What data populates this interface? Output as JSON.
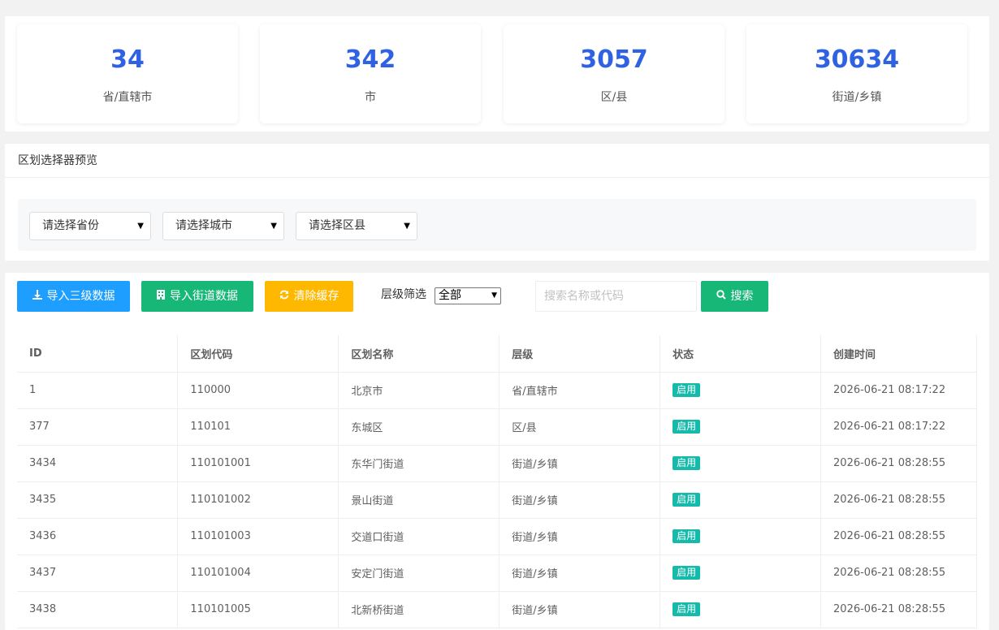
{
  "stats": [
    {
      "value": "34",
      "label": "省/直辖市"
    },
    {
      "value": "342",
      "label": "市"
    },
    {
      "value": "3057",
      "label": "区/县"
    },
    {
      "value": "30634",
      "label": "街道/乡镇"
    }
  ],
  "selector": {
    "title": "区划选择器预览",
    "province": "请选择省份",
    "city": "请选择城市",
    "district": "请选择区县"
  },
  "toolbar": {
    "import_three": "导入三级数据",
    "import_street": "导入街道数据",
    "clear_cache": "清除缓存",
    "filter_label": "层级筛选",
    "filter_value": "全部",
    "search_placeholder": "搜索名称或代码",
    "search_button": "搜索"
  },
  "icons": {
    "import_three": "download-icon",
    "import_street": "building-icon",
    "clear_cache": "refresh-icon",
    "search": "search-icon"
  },
  "colors": {
    "primary": "#1e9fff",
    "green": "#16b777",
    "orange": "#ffb800",
    "stat_number": "#2f62e3",
    "badge": "#16baaa"
  },
  "table": {
    "headers": [
      "ID",
      "区划代码",
      "区划名称",
      "层级",
      "状态",
      "创建时间"
    ],
    "rows": [
      [
        "1",
        "110000",
        "北京市",
        "省/直辖市",
        "启用",
        "2026-06-21 08:17:22"
      ],
      [
        "377",
        "110101",
        "东城区",
        "区/县",
        "启用",
        "2026-06-21 08:17:22"
      ],
      [
        "3434",
        "110101001",
        "东华门街道",
        "街道/乡镇",
        "启用",
        "2026-06-21 08:28:55"
      ],
      [
        "3435",
        "110101002",
        "景山街道",
        "街道/乡镇",
        "启用",
        "2026-06-21 08:28:55"
      ],
      [
        "3436",
        "110101003",
        "交道口街道",
        "街道/乡镇",
        "启用",
        "2026-06-21 08:28:55"
      ],
      [
        "3437",
        "110101004",
        "安定门街道",
        "街道/乡镇",
        "启用",
        "2026-06-21 08:28:55"
      ],
      [
        "3438",
        "110101005",
        "北新桥街道",
        "街道/乡镇",
        "启用",
        "2026-06-21 08:28:55"
      ]
    ]
  }
}
